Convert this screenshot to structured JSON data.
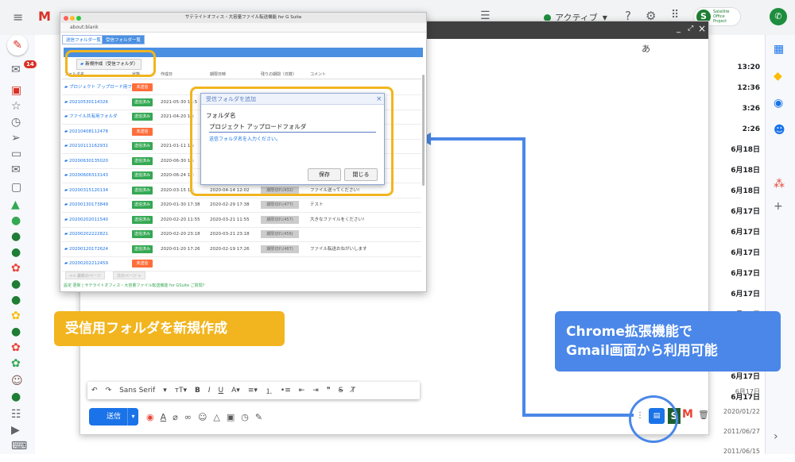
{
  "topbar": {
    "status": "アクティブ",
    "logo_text": "Gmail",
    "brand": "Satellite Office Project"
  },
  "compose": {
    "close_label": "×",
    "lang": "あ"
  },
  "inbox_times": [
    "13:20",
    "12:36",
    "3:26",
    "2:26",
    "6月18日",
    "6月18日",
    "6月18日",
    "6月17日",
    "6月17日",
    "6月17日",
    "6月17日",
    "6月17日",
    "6月17日",
    "6月17日",
    "6月17日",
    "6月17日",
    "6月17日",
    "6月17日",
    "2020/01/22",
    "2011/06/27",
    "2011/06/15"
  ],
  "ext": {
    "title": "サテライトオフィス・大容量ファイル転送機能 for G Suite",
    "url": "about:blank",
    "tab_sent": "送信フォルダ一覧",
    "tab_recv": "受信フォルダ一覧",
    "new_button": "新規作成（受信フォルダ）",
    "headers": [
      "フォルダ名",
      "状態",
      "作成日",
      "期限日時",
      "残りの期間（日数）",
      "コメント"
    ],
    "rows": [
      {
        "name": "プロジェクト アップロード用フ",
        "status": "未送信",
        "c1": "",
        "c2": "",
        "rem": "",
        "cm": ""
      },
      {
        "name": "20210530114326",
        "status": "送信済み",
        "c1": "2021-05-30 11:5",
        "c2": "",
        "rem": "",
        "cm": "ェクトのファー"
      },
      {
        "name": "ファイル共有用フォルダ",
        "status": "送信済み",
        "c1": "2021-04-20 18:",
        "c2": "",
        "rem": "",
        "cm": "ェクトのお願ー"
      },
      {
        "name": "20210408112478",
        "status": "未送信",
        "c1": "",
        "c2": "",
        "rem": "",
        "cm": ""
      },
      {
        "name": "20210111162931",
        "status": "送信済み",
        "c1": "2021-01-11 16:",
        "c2": "",
        "rem": "",
        "cm": "ムで。"
      },
      {
        "name": "20200630135020",
        "status": "送信済み",
        "c1": "2020-06-30 13:",
        "c2": "",
        "rem": "",
        "cm": ""
      },
      {
        "name": "20200606313143",
        "status": "送信済み",
        "c1": "2020-06-24 17:",
        "c2": "",
        "rem": "",
        "cm": ""
      },
      {
        "name": "20200315120134",
        "status": "送信済み",
        "c1": "2020-03-15 12:",
        "c2": "2020-04-14 12:02",
        "rem": "期限切れ(432)",
        "cm": "ファイル送ってください!"
      },
      {
        "name": "20200130173849",
        "status": "送信済み",
        "c1": "2020-01-30 17:38",
        "c2": "2020-02-29 17:38",
        "rem": "期限切れ(477)",
        "cm": "テスト"
      },
      {
        "name": "20200202011540",
        "status": "送信済み",
        "c1": "2020-02-20 11:55",
        "c2": "2020-03-21 11:55",
        "rem": "期限切れ(457)",
        "cm": "大きなファイルをください!"
      },
      {
        "name": "20200202222821",
        "status": "送信済み",
        "c1": "2020-02-20 23:18",
        "c2": "2020-03-21 23:18",
        "rem": "期限切れ(456)",
        "cm": ""
      },
      {
        "name": "20200120172624",
        "status": "送信済み",
        "c1": "2020-01-20 17:26",
        "c2": "2020-02-19 17:26",
        "rem": "期限切れ(487)",
        "cm": "ファイル転送おねがいします"
      },
      {
        "name": "20200202212459",
        "status": "未送信",
        "c1": "",
        "c2": "",
        "rem": "",
        "cm": ""
      }
    ],
    "pager": "<< 最新のページ",
    "pager_next": "次のページ >",
    "footer": "設定 更新 | サテライトオフィス・大容量ファイル転送機能 for GSuite ご質問?"
  },
  "dialog": {
    "title": "受信フォルダを追加",
    "field_label": "フォルダ名",
    "value": "プロジェクト アップロードフォルダ",
    "hint": "送信フォルダ名を入力ください。",
    "save": "保存",
    "close": "閉じる"
  },
  "callouts": {
    "left": "受信用フォルダを新規作成",
    "right_line1": "Chrome拡張機能で",
    "right_line2": "Gmail画面から利用可能"
  },
  "toolbar": {
    "font": "Sans Serif",
    "send": "送信"
  },
  "colors": {
    "accent": "#1a73e8",
    "highlight": "#f2b51f",
    "callout_blue": "#4a87e8",
    "sent": "#34a853",
    "unsent": "#ff6d3a"
  }
}
